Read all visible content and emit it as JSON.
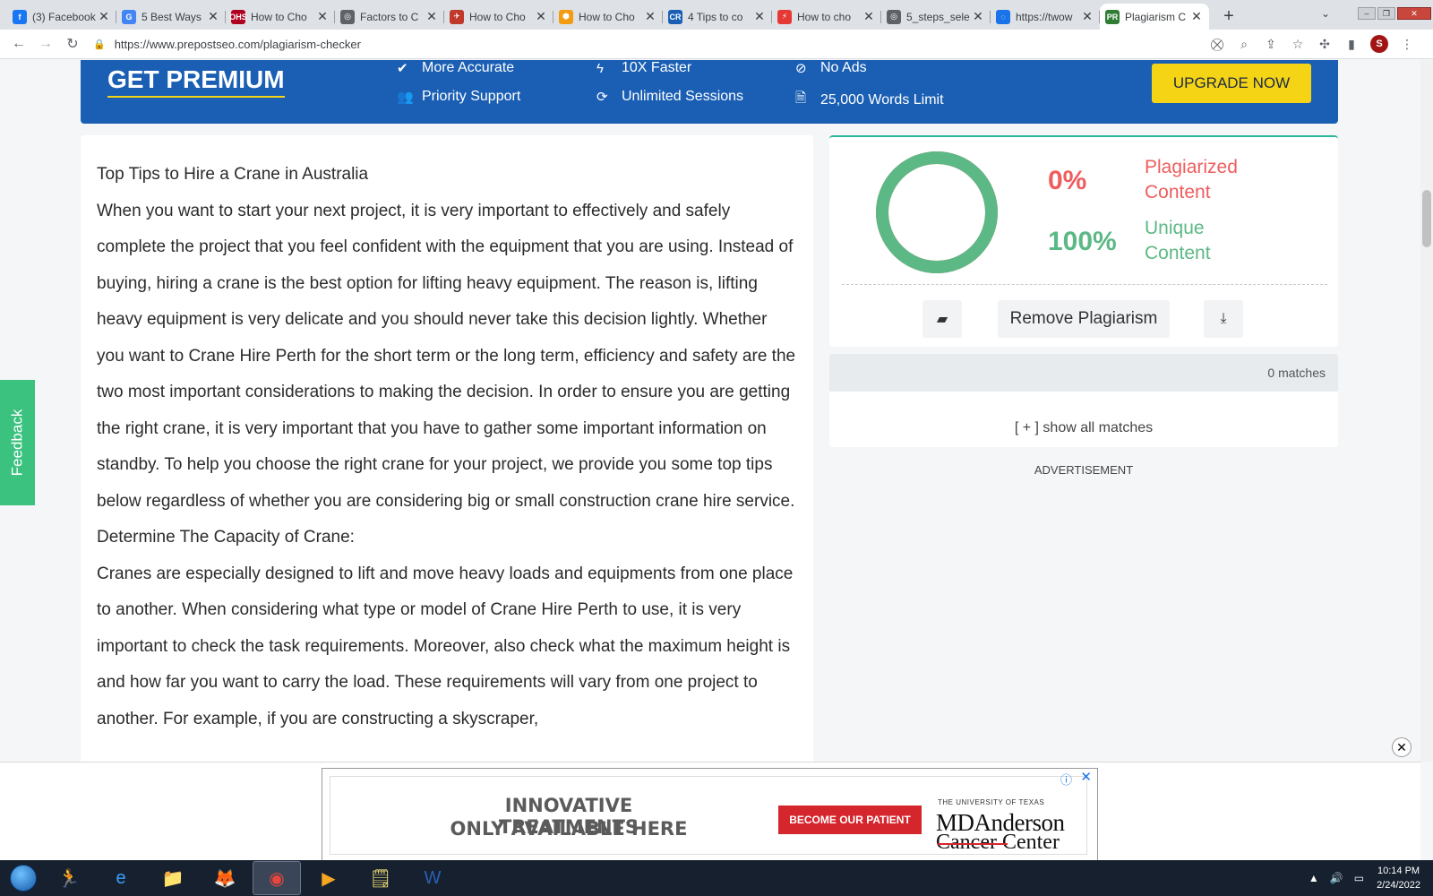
{
  "browser": {
    "tabs": [
      {
        "title": "(3) Facebook",
        "icon": "facebook-icon",
        "color": "#1877f2",
        "glyph": "f"
      },
      {
        "title": "5 Best Ways",
        "icon": "google-icon",
        "color": "#4285f4",
        "glyph": "G"
      },
      {
        "title": "How to Cho",
        "icon": "ohs-icon",
        "color": "#b00020",
        "glyph": "OHS"
      },
      {
        "title": "Factors to C",
        "icon": "globe-icon",
        "color": "#5f6368",
        "glyph": "◎"
      },
      {
        "title": "How to Cho",
        "icon": "crane-icon",
        "color": "#c0392b",
        "glyph": "✈"
      },
      {
        "title": "How to Cho",
        "icon": "hexagon-icon",
        "color": "#f39c12",
        "glyph": "⬢"
      },
      {
        "title": "4 Tips to co",
        "icon": "cr-icon",
        "color": "#1a5fb4",
        "glyph": "CR"
      },
      {
        "title": "How to cho",
        "icon": "bolt-icon",
        "color": "#e53935",
        "glyph": "⚡"
      },
      {
        "title": "5_steps_sele",
        "icon": "globe-icon",
        "color": "#5f6368",
        "glyph": "◎"
      },
      {
        "title": "https://twow",
        "icon": "loading-icon",
        "color": "#1a73e8",
        "glyph": "◌"
      },
      {
        "title": "Plagiarism C",
        "icon": "prepostseo-icon",
        "color": "#2e7d32",
        "glyph": "PR"
      }
    ],
    "url": "https://www.prepostseo.com/plagiarism-checker",
    "profile_initial": "S"
  },
  "premium": {
    "title": "GET PREMIUM",
    "features": [
      "More Accurate",
      "10X Faster",
      "No Ads",
      "Priority Support",
      "Unlimited Sessions",
      "25,000 Words Limit"
    ],
    "upgrade_label": "UPGRADE NOW"
  },
  "content": {
    "paragraphs": [
      "Top Tips to Hire a Crane in Australia",
      "When you want to start your next project, it is very important to effectively and safely complete the project that you feel confident with the equipment that you are using. Instead of buying, hiring a crane is the best option for lifting heavy equipment. The reason is, lifting heavy equipment is very delicate and you should never take this decision lightly. Whether you want to Crane Hire Perth for the short term or the long term, efficiency and safety are the two most important considerations to making the decision. In order to ensure you are getting the right crane, it is very important that you have to gather some important information on standby. To help you choose the right crane for your project, we provide you some top tips below regardless of whether you are considering big or small construction crane hire service.",
      "Determine The Capacity of Crane:",
      "Cranes are especially designed to lift and move heavy loads and equipments from one place to another. When considering what type or model of Crane Hire Perth to use, it is very important to check the task requirements. Moreover, also check what the maximum height is and how far you want to carry the load. These requirements will vary from one project to another. For example, if you are constructing a skyscraper,"
    ]
  },
  "result": {
    "plagiarized_pct": "0%",
    "plagiarized_label": "Plagiarized Content",
    "unique_pct": "100%",
    "unique_label": "Unique Content",
    "unique_fraction": 1.0,
    "remove_label": "Remove Plagiarism",
    "matches_label": "0 matches",
    "show_all_label": "[ + ] show all matches",
    "advertisement_label": "ADVERTISEMENT"
  },
  "feedback_label": "Feedback",
  "ad": {
    "line1": "INNOVATIVE TREATMENTS",
    "line2": "ONLY AVAILABLE HERE",
    "cta": "BECOME OUR PATIENT",
    "org_small": "THE UNIVERSITY OF TEXAS",
    "org_name": "MDAnderson",
    "org_sub": "Cancer Center"
  },
  "taskbar": {
    "time": "10:14 PM",
    "date": "2/24/2022"
  },
  "colors": {
    "plagiarized": "#ef5d5d",
    "unique": "#5cb885",
    "premium_bg": "#1a5fb4",
    "upgrade_bg": "#f5d415",
    "feedback_bg": "#3ac27e"
  }
}
